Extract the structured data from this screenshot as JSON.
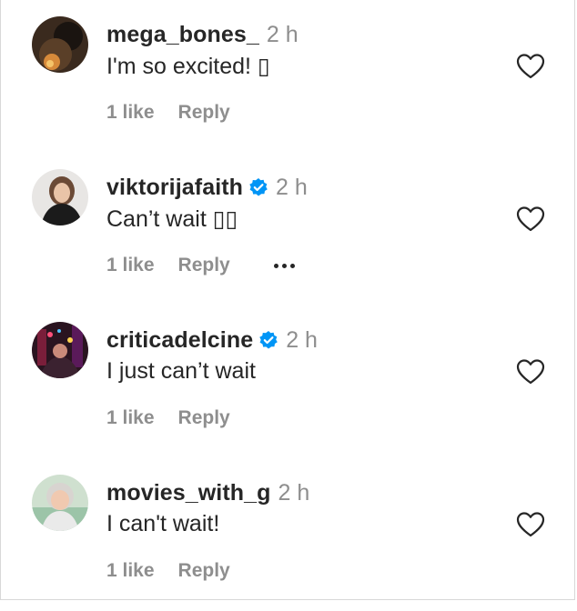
{
  "comments": [
    {
      "username": "mega_bones_",
      "verified": false,
      "time": "2 h",
      "text": "I'm so excited! ▯",
      "likes": "1 like",
      "reply": "Reply"
    },
    {
      "username": "viktorijafaith",
      "verified": true,
      "time": "2 h",
      "text": "Can’t wait ▯▯",
      "likes": "1 like",
      "reply": "Reply",
      "more": "more-options-icon"
    },
    {
      "username": "criticadelcine",
      "verified": true,
      "time": "2 h",
      "text": "I just can’t wait",
      "likes": "1 like",
      "reply": "Reply"
    },
    {
      "username": "movies_with_g",
      "verified": false,
      "time": "2 h",
      "text": "I can't wait!",
      "likes": "1 like",
      "reply": "Reply"
    }
  ],
  "colors": {
    "text": "#262626",
    "secondary": "#8e8e8e",
    "verified": "#0095f6"
  },
  "icons": {
    "like": "heart-outline-icon",
    "verified": "verified-badge-icon"
  }
}
